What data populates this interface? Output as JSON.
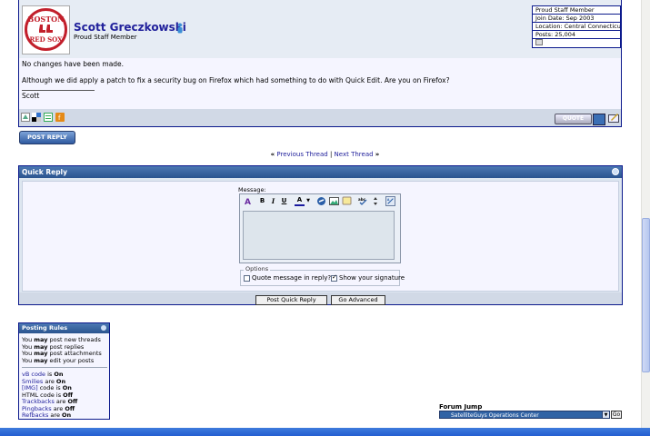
{
  "post": {
    "avatar_text_top": "BOSTON",
    "avatar_text_bottom": "RED SOX",
    "username": "Scott Greczkowski",
    "usertitle": "Proud Staff Member",
    "userinfo": [
      "Proud Staff Member",
      "Join Date: Sep 2003",
      "Location: Central Connecticut",
      "Posts: 25,004"
    ],
    "line1": "No changes have been made.",
    "line2": "Although we did apply a patch to fix a security bug on Firefox which had something to do with Quick Edit. Are you on Firefox?",
    "signature": "Scott",
    "quote_label": "QUOTE",
    "colors": {
      "border": "#0b198c",
      "header": "#e6ecf4",
      "accent_red": "#c21f2b"
    }
  },
  "post_reply_label": "POST REPLY",
  "thread_nav": {
    "prev_arrow": "«",
    "prev": "Previous Thread",
    "separator": "|",
    "next": "Next Thread",
    "next_arrow": "»"
  },
  "quick_reply": {
    "title": "Quick Reply",
    "message_label": "Message:",
    "toolbar": {
      "bold": "B",
      "italic": "I",
      "underline": "U",
      "color": "A"
    },
    "options_legend": "Options",
    "option_quote": "Quote message in reply?",
    "option_quote_checked": false,
    "option_signature": "Show your signature",
    "option_signature_checked": true,
    "post_button": "Post Quick Reply",
    "advanced_button": "Go Advanced"
  },
  "posting_rules": {
    "title": "Posting Rules",
    "perms": [
      {
        "pre": "You ",
        "bold": "may",
        "post": " post new threads"
      },
      {
        "pre": "You ",
        "bold": "may",
        "post": " post replies"
      },
      {
        "pre": "You ",
        "bold": "may",
        "post": " post attachments"
      },
      {
        "pre": "You ",
        "bold": "may",
        "post": " edit your posts"
      }
    ],
    "codes": [
      {
        "name": "vB code",
        "link": true,
        "mid": " is ",
        "state": "On"
      },
      {
        "name": "Smilies",
        "link": true,
        "mid": " are ",
        "state": "On"
      },
      {
        "name": "[IMG]",
        "link": true,
        "mid": " code is ",
        "state": "On"
      },
      {
        "name": "HTML code",
        "link": false,
        "mid": " is ",
        "state": "Off"
      },
      {
        "name": "Trackbacks",
        "link": true,
        "mid": " are ",
        "state": "Off"
      },
      {
        "name": "Pingbacks",
        "link": true,
        "mid": " are ",
        "state": "Off"
      },
      {
        "name": "Refbacks",
        "link": true,
        "mid": " are ",
        "state": "On"
      }
    ]
  },
  "forum_jump": {
    "label": "Forum Jump",
    "selected": "SatelliteGuys Operations Center",
    "go": "Go"
  }
}
